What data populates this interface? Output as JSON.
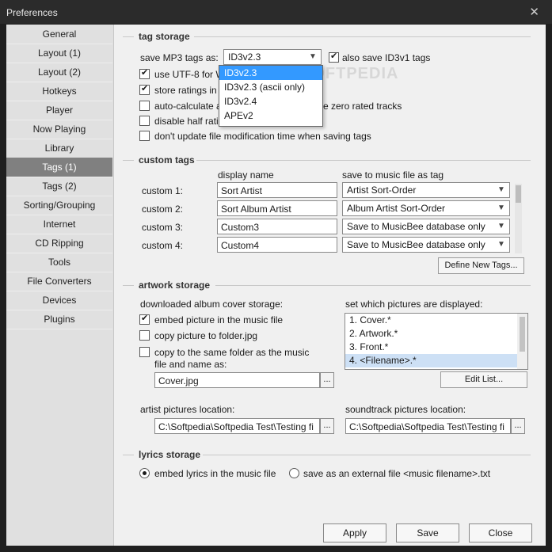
{
  "window": {
    "title": "Preferences",
    "close_glyph": "✕"
  },
  "sidebar": {
    "items": [
      {
        "label": "General"
      },
      {
        "label": "Layout (1)"
      },
      {
        "label": "Layout (2)"
      },
      {
        "label": "Hotkeys"
      },
      {
        "label": "Player"
      },
      {
        "label": "Now Playing"
      },
      {
        "label": "Library"
      },
      {
        "label": "Tags (1)",
        "active": true
      },
      {
        "label": "Tags (2)"
      },
      {
        "label": "Sorting/Grouping"
      },
      {
        "label": "Internet"
      },
      {
        "label": "CD Ripping"
      },
      {
        "label": "Tools"
      },
      {
        "label": "File Converters"
      },
      {
        "label": "Devices"
      },
      {
        "label": "Plugins"
      }
    ]
  },
  "tag_storage": {
    "heading": "tag storage",
    "save_label": "save MP3 tags as:",
    "save_value": "ID3v2.3",
    "also_id3v1": {
      "label": "also save ID3v1 tags",
      "checked": true
    },
    "utf8": {
      "label": "use UTF-8 for W",
      "checked": true
    },
    "ratings": {
      "label": "store ratings in th",
      "checked": true
    },
    "autocalc": {
      "label": "auto-calculate al",
      "checked": false
    },
    "autocalc_tail": "e zero rated tracks",
    "halfrating": {
      "label": "disable half rating",
      "checked": false
    },
    "nomodtime": {
      "label": "don't update file modification time when saving tags",
      "checked": false
    },
    "dropdown_options": [
      "ID3v2.3",
      "ID3v2.3 (ascii only)",
      "ID3v2.4",
      "APEv2"
    ],
    "watermark": "SOFTPEDIA"
  },
  "custom_tags": {
    "heading": "custom tags",
    "col_display": "display name",
    "col_save": "save to music file as tag",
    "rows": [
      {
        "label": "custom 1:",
        "name": "Sort Artist",
        "tag": "Artist Sort-Order"
      },
      {
        "label": "custom 2:",
        "name": "Sort Album Artist",
        "tag": "Album Artist Sort-Order"
      },
      {
        "label": "custom 3:",
        "name": "Custom3",
        "tag": "Save to MusicBee database only"
      },
      {
        "label": "custom 4:",
        "name": "Custom4",
        "tag": "Save to MusicBee database only"
      }
    ],
    "define_button": "Define New Tags..."
  },
  "artwork": {
    "heading": "artwork storage",
    "downloaded_label": "downloaded album cover storage:",
    "embed": {
      "label": "embed picture in the music file",
      "checked": true
    },
    "copy_folder": {
      "label": "copy picture to folder.jpg",
      "checked": false
    },
    "copy_same": {
      "label": "copy to the same folder as the music",
      "label2": "file and name as:",
      "checked": false
    },
    "filename_value": "Cover.jpg",
    "pictures_label": "set which pictures are displayed:",
    "pictures": [
      "1. Cover.*",
      "2. Artwork.*",
      "3. Front.*",
      "4. <Filename>.*"
    ],
    "edit_button": "Edit List...",
    "artist_loc_label": "artist pictures location:",
    "artist_loc_value": "C:\\Softpedia\\Softpedia Test\\Testing fi",
    "soundtrack_loc_label": "soundtrack pictures location:",
    "soundtrack_loc_value": "C:\\Softpedia\\Softpedia Test\\Testing fi",
    "ellipsis": "..."
  },
  "lyrics": {
    "heading": "lyrics storage",
    "embed": {
      "label": "embed lyrics in the music file",
      "checked": true
    },
    "external": {
      "label": "save as an external file <music filename>.txt",
      "checked": false
    }
  },
  "footer": {
    "apply": "Apply",
    "save": "Save",
    "close": "Close"
  }
}
